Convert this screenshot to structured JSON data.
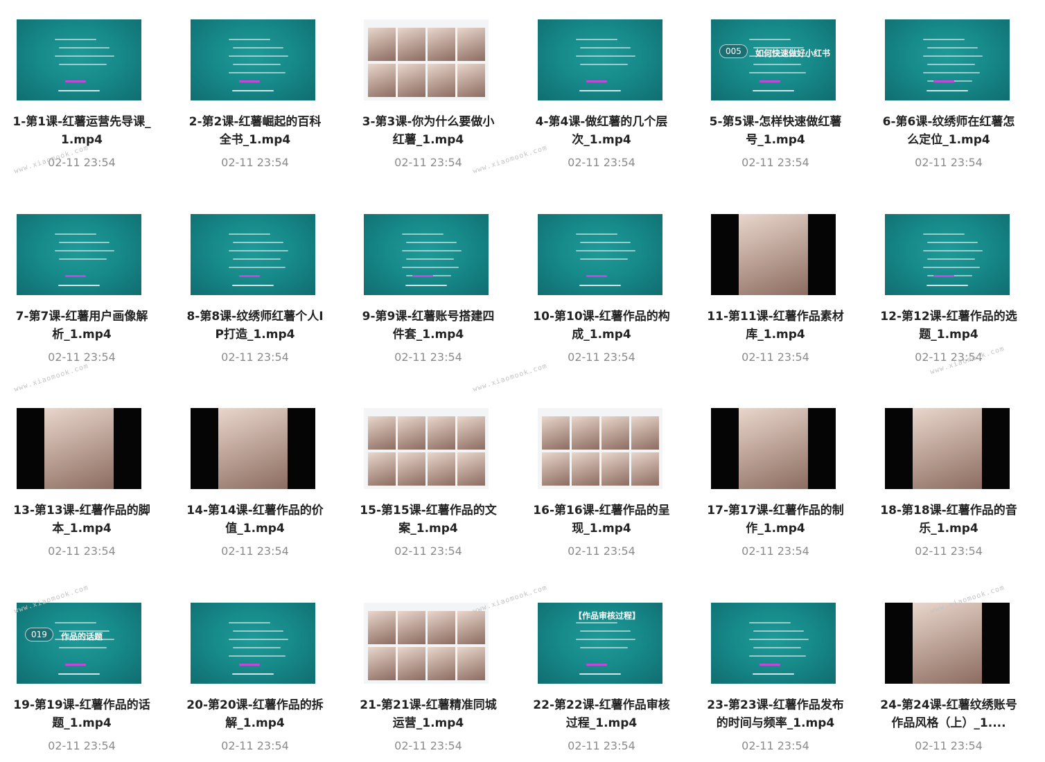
{
  "items": [
    {
      "title": "1-第1课-红薯运营先导课_1.mp4",
      "date": "02-11 23:54",
      "thumb": "teal",
      "icon": "video-thumbnail"
    },
    {
      "title": "2-第2课-红薯崛起的百科全书_1.mp4",
      "date": "02-11 23:54",
      "thumb": "teal",
      "icon": "video-thumbnail"
    },
    {
      "title": "3-第3课-你为什么要做小红薯_1.mp4",
      "date": "02-11 23:54",
      "thumb": "white",
      "icon": "video-thumbnail"
    },
    {
      "title": "4-第4课-做红薯的几个层次_1.mp4",
      "date": "02-11 23:54",
      "thumb": "teal",
      "icon": "video-thumbnail"
    },
    {
      "title": "5-第5课-怎样快速做红薯号_1.mp4",
      "date": "02-11 23:54",
      "thumb": "teal",
      "icon": "video-thumbnail",
      "badge": "005",
      "caption": "如何快速做好小红书"
    },
    {
      "title": "6-第6课-纹绣师在红薯怎么定位_1.mp4",
      "date": "02-11 23:54",
      "thumb": "teal",
      "icon": "video-thumbnail"
    },
    {
      "title": "7-第7课-红薯用户画像解析_1.mp4",
      "date": "02-11 23:54",
      "thumb": "teal",
      "icon": "video-thumbnail"
    },
    {
      "title": "8-第8课-纹绣师红薯个人IP打造_1.mp4",
      "date": "02-11 23:54",
      "thumb": "teal",
      "icon": "video-thumbnail"
    },
    {
      "title": "9-第9课-红薯账号搭建四件套_1.mp4",
      "date": "02-11 23:54",
      "thumb": "teal",
      "icon": "video-thumbnail"
    },
    {
      "title": "10-第10课-红薯作品的构成_1.mp4",
      "date": "02-11 23:54",
      "thumb": "teal",
      "icon": "video-thumbnail"
    },
    {
      "title": "11-第11课-红薯作品素材库_1.mp4",
      "date": "02-11 23:54",
      "thumb": "dark",
      "icon": "video-thumbnail"
    },
    {
      "title": "12-第12课-红薯作品的选题_1.mp4",
      "date": "02-11 23:54",
      "thumb": "teal",
      "icon": "video-thumbnail"
    },
    {
      "title": "13-第13课-红薯作品的脚本_1.mp4",
      "date": "02-11 23:54",
      "thumb": "dark",
      "icon": "video-thumbnail"
    },
    {
      "title": "14-第14课-红薯作品的价值_1.mp4",
      "date": "02-11 23:54",
      "thumb": "dark",
      "icon": "video-thumbnail"
    },
    {
      "title": "15-第15课-红薯作品的文案_1.mp4",
      "date": "02-11 23:54",
      "thumb": "white",
      "icon": "video-thumbnail"
    },
    {
      "title": "16-第16课-红薯作品的呈现_1.mp4",
      "date": "02-11 23:54",
      "thumb": "white",
      "icon": "video-thumbnail"
    },
    {
      "title": "17-第17课-红薯作品的制作_1.mp4",
      "date": "02-11 23:54",
      "thumb": "dark",
      "icon": "video-thumbnail"
    },
    {
      "title": "18-第18课-红薯作品的音乐_1.mp4",
      "date": "02-11 23:54",
      "thumb": "dark",
      "icon": "video-thumbnail"
    },
    {
      "title": "19-第19课-红薯作品的话题_1.mp4",
      "date": "02-11 23:54",
      "thumb": "teal",
      "icon": "video-thumbnail",
      "badge": "019",
      "caption": "作品的话题"
    },
    {
      "title": "20-第20课-红薯作品的拆解_1.mp4",
      "date": "02-11 23:54",
      "thumb": "teal",
      "icon": "video-thumbnail"
    },
    {
      "title": "21-第21课-红薯精准同城运营_1.mp4",
      "date": "02-11 23:54",
      "thumb": "white",
      "icon": "video-thumbnail"
    },
    {
      "title": "22-第22课-红薯作品审核过程_1.mp4",
      "date": "02-11 23:54",
      "thumb": "teal",
      "icon": "video-thumbnail",
      "caption": "【作品审核过程】"
    },
    {
      "title": "23-第23课-红薯作品发布的时间与频率_1.mp4",
      "date": "02-11 23:54",
      "thumb": "teal",
      "icon": "video-thumbnail"
    },
    {
      "title": "24-第24课-红薯纹绣账号作品风格（上）_1....",
      "date": "02-11 23:54",
      "thumb": "dark",
      "icon": "video-thumbnail"
    }
  ],
  "watermark": "www.xiaomook.com"
}
